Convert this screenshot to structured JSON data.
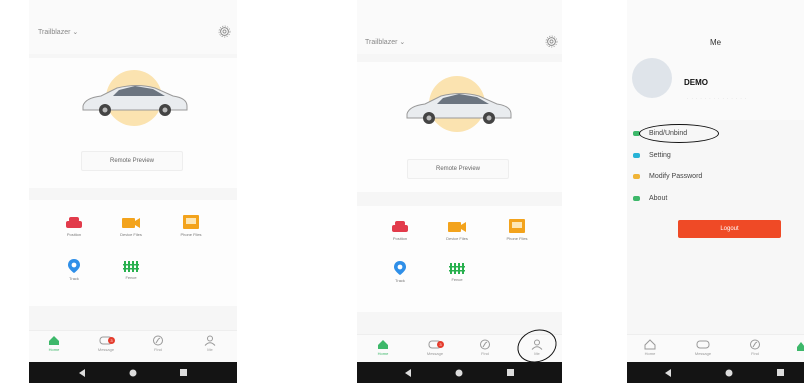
{
  "screen1": {
    "brand": "Trailblazer ⌄",
    "remote_preview": "Remote Preview",
    "tiles": [
      {
        "label": "Position",
        "color": "#e23b4b"
      },
      {
        "label": "Device Files",
        "color": "#f3a31c"
      },
      {
        "label": "Phone Files",
        "color": "#f3a31c"
      },
      {
        "label": "Track",
        "color": "#2f8fe8"
      },
      {
        "label": "Fence",
        "color": "#28b04e"
      }
    ],
    "tabs": [
      {
        "label": "Home",
        "active": true
      },
      {
        "label": "Message",
        "badge": "3"
      },
      {
        "label": "Find"
      },
      {
        "label": "Me"
      }
    ]
  },
  "screen2": {
    "brand": "Trailblazer ⌄",
    "remote_preview": "Remote Preview",
    "tiles": [
      {
        "label": "Position"
      },
      {
        "label": "Device Files"
      },
      {
        "label": "Phone Files"
      },
      {
        "label": "Track"
      },
      {
        "label": "Fence"
      }
    ],
    "tabs": [
      {
        "label": "Home",
        "active": true
      },
      {
        "label": "Message",
        "badge": "3"
      },
      {
        "label": "Find"
      },
      {
        "label": "Me"
      }
    ]
  },
  "screen3": {
    "title": "Me",
    "username": "DEMO",
    "menu": [
      {
        "label": "Bind/Unbind",
        "icon": "link-icon",
        "color": "#3db86a"
      },
      {
        "label": "Setting",
        "icon": "gear-icon",
        "color": "#27b3d6"
      },
      {
        "label": "Modify Password",
        "icon": "key-icon",
        "color": "#f0b437"
      },
      {
        "label": "About",
        "icon": "info-icon",
        "color": "#3db86a"
      }
    ],
    "logout": "Logout",
    "tabs": [
      {
        "label": "Home"
      },
      {
        "label": "Message"
      },
      {
        "label": "Find"
      }
    ]
  },
  "colors": {
    "accent_green": "#3db86a",
    "logout_red": "#ef4a26",
    "badge_red": "#e53b2c"
  }
}
